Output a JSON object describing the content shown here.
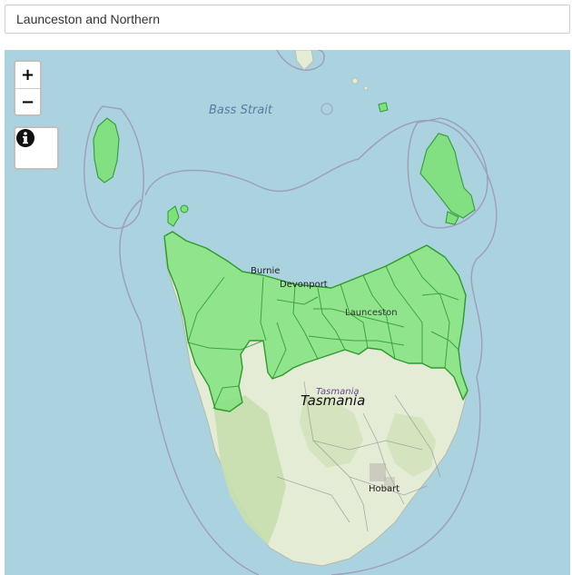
{
  "search": {
    "value": "Launceston and Northern"
  },
  "controls": {
    "zoom_in": "+",
    "zoom_out": "−"
  },
  "map": {
    "labels": {
      "sea": "Bass Strait",
      "burnie": "Burnie",
      "devonport": "Devonport",
      "launceston": "Launceston",
      "tasmania_small": "Tasmania",
      "tasmania": "Tasmania",
      "hobart": "Hobart"
    },
    "colors": {
      "water": "#aad3df",
      "land": "#e4ecd6",
      "forest": "#c8dfae",
      "highlight_fill": "#7ee27a",
      "highlight_stroke": "#2e9b2e"
    }
  }
}
